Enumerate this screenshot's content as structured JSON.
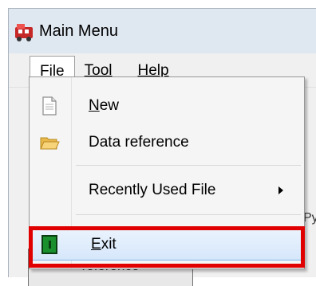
{
  "window": {
    "title": "Main Menu"
  },
  "menubar": {
    "items": [
      {
        "label": "File"
      },
      {
        "label": "Tool"
      },
      {
        "label": "Help"
      }
    ]
  },
  "file_menu": {
    "items": [
      {
        "label": "New",
        "icon": "document-icon"
      },
      {
        "label": "Data reference",
        "icon": "folder-icon"
      },
      {
        "label": "Recently Used File",
        "icon": "",
        "submenu": true
      },
      {
        "label": "Exit",
        "icon": "exit-icon",
        "highlighted": true
      }
    ]
  },
  "background": {
    "partial_text": "Py",
    "button_label": "reference"
  },
  "colors": {
    "highlight_border": "#7eb4ea",
    "annotation_red": "#e00000",
    "exit_icon_green": "#1a8f2e"
  }
}
